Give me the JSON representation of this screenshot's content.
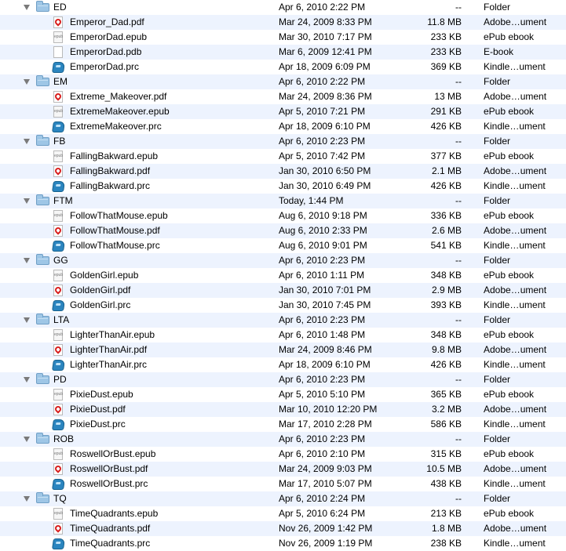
{
  "groups": [
    {
      "name": "ED",
      "date": "Apr 6, 2010 2:22 PM",
      "size": "--",
      "kind": "Folder",
      "files": [
        {
          "icon": "pdf",
          "name": "Emperor_Dad.pdf",
          "date": "Mar 24, 2009 8:33 PM",
          "size": "11.8 MB",
          "kind": "Adobe…ument"
        },
        {
          "icon": "epub",
          "name": "EmperorDad.epub",
          "date": "Mar 30, 2010 7:17 PM",
          "size": "233 KB",
          "kind": "ePub ebook"
        },
        {
          "icon": "pdb",
          "name": "EmperorDad.pdb",
          "date": "Mar 6, 2009 12:41 PM",
          "size": "233 KB",
          "kind": "E-book"
        },
        {
          "icon": "prc",
          "name": "EmperorDad.prc",
          "date": "Apr 18, 2009 6:09 PM",
          "size": "369 KB",
          "kind": "Kindle…ument"
        }
      ]
    },
    {
      "name": "EM",
      "date": "Apr 6, 2010 2:22 PM",
      "size": "--",
      "kind": "Folder",
      "files": [
        {
          "icon": "pdf",
          "name": "Extreme_Makeover.pdf",
          "date": "Mar 24, 2009 8:36 PM",
          "size": "13 MB",
          "kind": "Adobe…ument"
        },
        {
          "icon": "epub",
          "name": "ExtremeMakeover.epub",
          "date": "Apr 5, 2010 7:21 PM",
          "size": "291 KB",
          "kind": "ePub ebook"
        },
        {
          "icon": "prc",
          "name": "ExtremeMakeover.prc",
          "date": "Apr 18, 2009 6:10 PM",
          "size": "426 KB",
          "kind": "Kindle…ument"
        }
      ]
    },
    {
      "name": "FB",
      "date": "Apr 6, 2010 2:23 PM",
      "size": "--",
      "kind": "Folder",
      "files": [
        {
          "icon": "epub",
          "name": "FallingBakward.epub",
          "date": "Apr 5, 2010 7:42 PM",
          "size": "377 KB",
          "kind": "ePub ebook"
        },
        {
          "icon": "pdf",
          "name": "FallingBakward.pdf",
          "date": "Jan 30, 2010 6:50 PM",
          "size": "2.1 MB",
          "kind": "Adobe…ument"
        },
        {
          "icon": "prc",
          "name": "FallingBakward.prc",
          "date": "Jan 30, 2010 6:49 PM",
          "size": "426 KB",
          "kind": "Kindle…ument"
        }
      ]
    },
    {
      "name": "FTM",
      "date": "Today, 1:44 PM",
      "size": "--",
      "kind": "Folder",
      "files": [
        {
          "icon": "epub",
          "name": "FollowThatMouse.epub",
          "date": "Aug 6, 2010 9:18 PM",
          "size": "336 KB",
          "kind": "ePub ebook"
        },
        {
          "icon": "pdf",
          "name": "FollowThatMouse.pdf",
          "date": "Aug 6, 2010 2:33 PM",
          "size": "2.6 MB",
          "kind": "Adobe…ument"
        },
        {
          "icon": "prc",
          "name": "FollowThatMouse.prc",
          "date": "Aug 6, 2010 9:01 PM",
          "size": "541 KB",
          "kind": "Kindle…ument"
        }
      ]
    },
    {
      "name": "GG",
      "date": "Apr 6, 2010 2:23 PM",
      "size": "--",
      "kind": "Folder",
      "files": [
        {
          "icon": "epub",
          "name": "GoldenGirl.epub",
          "date": "Apr 6, 2010 1:11 PM",
          "size": "348 KB",
          "kind": "ePub ebook"
        },
        {
          "icon": "pdf",
          "name": "GoldenGirl.pdf",
          "date": "Jan 30, 2010 7:01 PM",
          "size": "2.9 MB",
          "kind": "Adobe…ument"
        },
        {
          "icon": "prc",
          "name": "GoldenGirl.prc",
          "date": "Jan 30, 2010 7:45 PM",
          "size": "393 KB",
          "kind": "Kindle…ument"
        }
      ]
    },
    {
      "name": "LTA",
      "date": "Apr 6, 2010 2:23 PM",
      "size": "--",
      "kind": "Folder",
      "files": [
        {
          "icon": "epub",
          "name": "LighterThanAir.epub",
          "date": "Apr 6, 2010 1:48 PM",
          "size": "348 KB",
          "kind": "ePub ebook"
        },
        {
          "icon": "pdf",
          "name": "LighterThanAir.pdf",
          "date": "Mar 24, 2009 8:46 PM",
          "size": "9.8 MB",
          "kind": "Adobe…ument"
        },
        {
          "icon": "prc",
          "name": "LighterThanAir.prc",
          "date": "Apr 18, 2009 6:10 PM",
          "size": "426 KB",
          "kind": "Kindle…ument"
        }
      ]
    },
    {
      "name": "PD",
      "date": "Apr 6, 2010 2:23 PM",
      "size": "--",
      "kind": "Folder",
      "files": [
        {
          "icon": "epub",
          "name": "PixieDust.epub",
          "date": "Apr 5, 2010 5:10 PM",
          "size": "365 KB",
          "kind": "ePub ebook"
        },
        {
          "icon": "pdf",
          "name": "PixieDust.pdf",
          "date": "Mar 10, 2010 12:20 PM",
          "size": "3.2 MB",
          "kind": "Adobe…ument"
        },
        {
          "icon": "prc",
          "name": "PixieDust.prc",
          "date": "Mar 17, 2010 2:28 PM",
          "size": "586 KB",
          "kind": "Kindle…ument"
        }
      ]
    },
    {
      "name": "ROB",
      "date": "Apr 6, 2010 2:23 PM",
      "size": "--",
      "kind": "Folder",
      "files": [
        {
          "icon": "epub",
          "name": "RoswellOrBust.epub",
          "date": "Apr 6, 2010 2:10 PM",
          "size": "315 KB",
          "kind": "ePub ebook"
        },
        {
          "icon": "pdf",
          "name": "RoswellOrBust.pdf",
          "date": "Mar 24, 2009 9:03 PM",
          "size": "10.5 MB",
          "kind": "Adobe…ument"
        },
        {
          "icon": "prc",
          "name": "RoswellOrBust.prc",
          "date": "Mar 17, 2010 5:07 PM",
          "size": "438 KB",
          "kind": "Kindle…ument"
        }
      ]
    },
    {
      "name": "TQ",
      "date": "Apr 6, 2010 2:24 PM",
      "size": "--",
      "kind": "Folder",
      "files": [
        {
          "icon": "epub",
          "name": "TimeQuadrants.epub",
          "date": "Apr 5, 2010 6:24 PM",
          "size": "213 KB",
          "kind": "ePub ebook"
        },
        {
          "icon": "pdf",
          "name": "TimeQuadrants.pdf",
          "date": "Nov 26, 2009 1:42 PM",
          "size": "1.8 MB",
          "kind": "Adobe…ument"
        },
        {
          "icon": "prc",
          "name": "TimeQuadrants.prc",
          "date": "Nov 26, 2009 1:19 PM",
          "size": "238 KB",
          "kind": "Kindle…ument"
        }
      ]
    }
  ]
}
